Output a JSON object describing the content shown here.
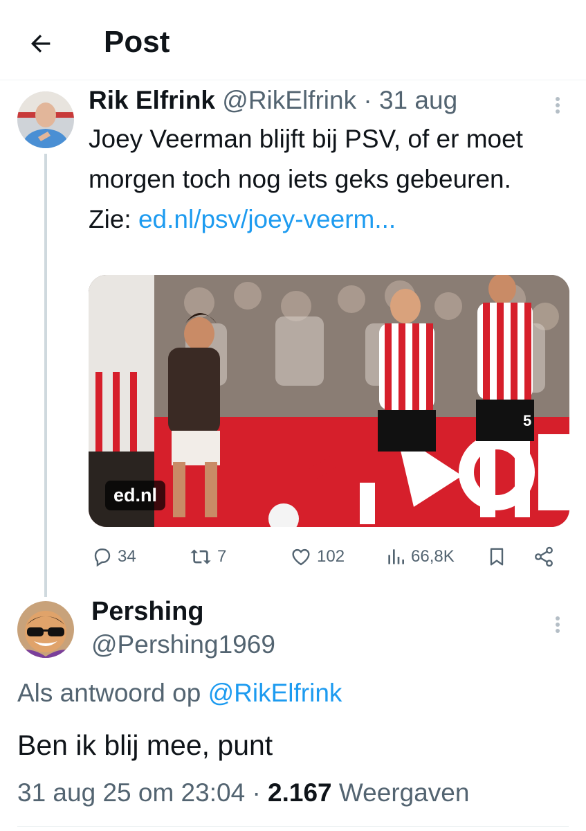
{
  "header": {
    "title": "Post"
  },
  "original": {
    "name": "Rik Elfrink",
    "handle": "@RikElfrink",
    "separator": "·",
    "date": "31 aug",
    "text_main": "Joey Veerman blijft bij PSV, of er moet morgen toch nog iets geks gebeuren. Zie: ",
    "link_text": "ed.nl/psv/joey-veerm...",
    "media_badge": "ed.nl",
    "jersey_number": "5",
    "stats": {
      "replies": "34",
      "reposts": "7",
      "likes": "102",
      "views": "66,8K"
    }
  },
  "reply": {
    "name": "Pershing",
    "handle": "@Pershing1969",
    "reply_prefix": "Als antwoord op",
    "reply_handle": "@RikElfrink",
    "text": "Ben ik blij mee, punt",
    "timestamp": "31 aug 25 om 23:04",
    "separator": "·",
    "view_count": "2.167",
    "view_label": "Weergaven"
  },
  "colors": {
    "link": "#1d9bf0",
    "muted": "#536471",
    "text": "#0f1419",
    "psv_red": "#d81e2c"
  }
}
